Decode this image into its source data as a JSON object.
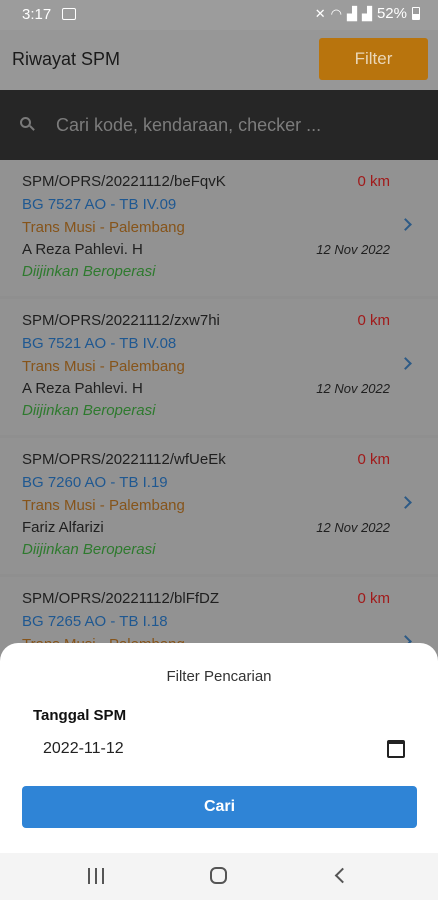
{
  "status_bar": {
    "time": "3:17",
    "battery": "52%"
  },
  "app_bar": {
    "title": "Riwayat SPM",
    "filter_label": "Filter"
  },
  "search": {
    "placeholder": "Cari kode, kendaraan, checker ..."
  },
  "items": [
    {
      "code": "SPM/OPRS/20221112/beFqvK",
      "km": "0 km",
      "vehicle": "BG 7527 AO - TB IV.09",
      "route": "Trans Musi - Palembang",
      "checker": "A Reza Pahlevi. H",
      "date": "12 Nov 2022",
      "status": "Diijinkan Beroperasi"
    },
    {
      "code": "SPM/OPRS/20221112/zxw7hi",
      "km": "0 km",
      "vehicle": "BG 7521 AO - TB IV.08",
      "route": "Trans Musi - Palembang",
      "checker": "A Reza Pahlevi. H",
      "date": "12 Nov 2022",
      "status": "Diijinkan Beroperasi"
    },
    {
      "code": "SPM/OPRS/20221112/wfUeEk",
      "km": "0 km",
      "vehicle": "BG 7260 AO - TB I.19",
      "route": "Trans Musi - Palembang",
      "checker": "Fariz Alfarizi",
      "date": "12 Nov 2022",
      "status": "Diijinkan Beroperasi"
    },
    {
      "code": "SPM/OPRS/20221112/blFfDZ",
      "km": "0 km",
      "vehicle": "BG 7265 AO - TB I.18",
      "route": "Trans Musi - Palembang",
      "checker": "",
      "date": "",
      "status": ""
    }
  ],
  "filter_sheet": {
    "title": "Filter Pencarian",
    "date_label": "Tanggal SPM",
    "date_value": "2022-11-12",
    "submit_label": "Cari"
  },
  "colors": {
    "accent": "#b8740d",
    "primary": "#2f84d6",
    "error": "#a11a1a",
    "success": "#2e7a2e"
  }
}
